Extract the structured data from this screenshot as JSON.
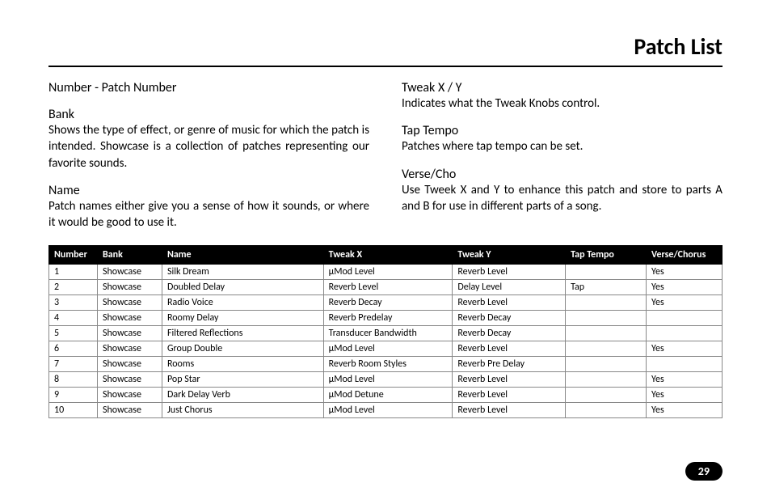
{
  "page_title": "Patch List",
  "page_number": "29",
  "left": {
    "number_heading": "Number - Patch Number",
    "bank_heading": "Bank",
    "bank_body": "Shows the type of effect, or genre of music for which the patch is intended. Showcase is a collection of patches representing our favorite sounds.",
    "name_heading": "Name",
    "name_body": "Patch names either give you a sense of how it sounds, or where it would be good to use it."
  },
  "right": {
    "tweak_heading": "Tweak X / Y",
    "tweak_body": "Indicates what the Tweak Knobs control.",
    "tap_heading": "Tap Tempo",
    "tap_body": "Patches where tap tempo can be set.",
    "verse_heading": "Verse/Cho",
    "verse_body": "Use Tweek X and Y to enhance this patch and store to parts A and B  for use in different parts of a song."
  },
  "table": {
    "headers": [
      "Number",
      "Bank",
      "Name",
      "Tweak X",
      "Tweak Y",
      "Tap Tempo",
      "Verse/Chorus"
    ],
    "rows": [
      [
        "1",
        "Showcase",
        "Silk Dream",
        "µMod Level",
        "Reverb Level",
        "",
        "Yes"
      ],
      [
        "2",
        "Showcase",
        "Doubled Delay",
        "Reverb Level",
        "Delay Level",
        "Tap",
        "Yes"
      ],
      [
        "3",
        "Showcase",
        "Radio Voice",
        "Reverb Decay",
        "Reverb Level",
        "",
        "Yes"
      ],
      [
        "4",
        "Showcase",
        "Roomy Delay",
        "Reverb Predelay",
        "Reverb Decay",
        "",
        ""
      ],
      [
        "5",
        "Showcase",
        "Filtered Reflections",
        "Transducer Bandwidth",
        "Reverb Decay",
        "",
        ""
      ],
      [
        "6",
        "Showcase",
        "Group Double",
        "µMod Level",
        "Reverb Level",
        "",
        "Yes"
      ],
      [
        "7",
        "Showcase",
        "Rooms",
        "Reverb Room Styles",
        "Reverb Pre Delay",
        "",
        ""
      ],
      [
        "8",
        "Showcase",
        "Pop Star",
        "µMod Level",
        "Reverb Level",
        "",
        "Yes"
      ],
      [
        "9",
        "Showcase",
        "Dark Delay Verb",
        "µMod Detune",
        "Reverb Level",
        "",
        "Yes"
      ],
      [
        "10",
        "Showcase",
        "Just Chorus",
        "µMod Level",
        "Reverb Level",
        "",
        "Yes"
      ]
    ]
  }
}
